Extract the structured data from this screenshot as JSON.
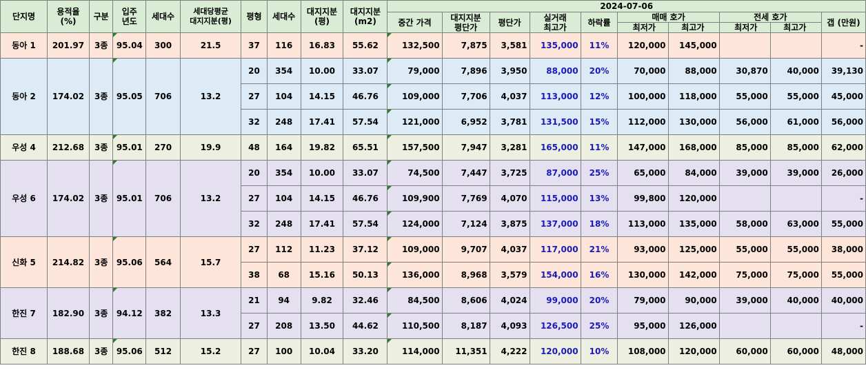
{
  "header": {
    "date": "2024-07-06",
    "complex": "단지명",
    "far": "용적율\n(%)",
    "zone": "구분",
    "year": "입주\n년도",
    "households": "세대수",
    "avg_land": "세대당평균\n대지지분(평)",
    "type": "평형",
    "type_households": "세대수",
    "land_pyeong": "대지지분\n(평)",
    "land_m2": "대지지분\n(m2)",
    "median_price": "중간 가격",
    "land_unit_price": "대지지분\n평단가",
    "unit_price": "평단가",
    "max_real_trade": "실거래\n최고가",
    "drop_rate": "하락률",
    "sale_group": "매매 호가",
    "jeonse_group": "전세 호가",
    "min": "최저가",
    "max": "최고가",
    "gap": "갭 (만원)"
  },
  "groups": [
    {
      "name": "동아 1",
      "far": "201.97",
      "zone": "3종",
      "year": "95.04",
      "households": "300",
      "avg_land": "21.5",
      "bg": "peach",
      "rows": [
        {
          "type": "37",
          "hh": "116",
          "lp": "16.83",
          "lm": "55.62",
          "median": "132,500",
          "lup": "7,875",
          "up": "3,581",
          "max": "135,000",
          "drop": "11%",
          "smin": "120,000",
          "smax": "145,000",
          "jmin": "",
          "jmax": "",
          "gap": "-"
        }
      ]
    },
    {
      "name": "동아 2",
      "far": "174.02",
      "zone": "3종",
      "year": "95.05",
      "households": "706",
      "avg_land": "13.2",
      "bg": "blue",
      "rows": [
        {
          "type": "20",
          "hh": "354",
          "lp": "10.00",
          "lm": "33.07",
          "median": "79,000",
          "lup": "7,896",
          "up": "3,950",
          "max": "88,000",
          "drop": "20%",
          "smin": "70,000",
          "smax": "88,000",
          "jmin": "30,870",
          "jmax": "40,000",
          "gap": "39,130"
        },
        {
          "type": "27",
          "hh": "104",
          "lp": "14.15",
          "lm": "46.76",
          "median": "109,000",
          "lup": "7,706",
          "up": "4,037",
          "max": "113,000",
          "drop": "12%",
          "smin": "100,000",
          "smax": "118,000",
          "jmin": "55,000",
          "jmax": "55,000",
          "gap": "45,000"
        },
        {
          "type": "32",
          "hh": "248",
          "lp": "17.41",
          "lm": "57.54",
          "median": "121,000",
          "lup": "6,952",
          "up": "3,781",
          "max": "131,500",
          "drop": "15%",
          "smin": "112,000",
          "smax": "130,000",
          "jmin": "56,000",
          "jmax": "61,000",
          "gap": "56,000"
        }
      ]
    },
    {
      "name": "우성 4",
      "far": "212.68",
      "zone": "3종",
      "year": "95.01",
      "households": "270",
      "avg_land": "19.9",
      "bg": "green",
      "rows": [
        {
          "type": "48",
          "hh": "164",
          "lp": "19.82",
          "lm": "65.51",
          "median": "157,500",
          "lup": "7,947",
          "up": "3,281",
          "max": "165,000",
          "drop": "11%",
          "smin": "147,000",
          "smax": "168,000",
          "jmin": "85,000",
          "jmax": "85,000",
          "gap": "62,000"
        }
      ]
    },
    {
      "name": "우성 6",
      "far": "174.02",
      "zone": "3종",
      "year": "95.01",
      "households": "706",
      "avg_land": "13.2",
      "bg": "purple",
      "rows": [
        {
          "type": "20",
          "hh": "354",
          "lp": "10.00",
          "lm": "33.07",
          "median": "74,500",
          "lup": "7,447",
          "up": "3,725",
          "max": "87,000",
          "drop": "25%",
          "smin": "65,000",
          "smax": "84,000",
          "jmin": "39,000",
          "jmax": "39,000",
          "gap": "26,000"
        },
        {
          "type": "27",
          "hh": "104",
          "lp": "14.15",
          "lm": "46.76",
          "median": "109,900",
          "lup": "7,769",
          "up": "4,070",
          "max": "115,000",
          "drop": "13%",
          "smin": "99,800",
          "smax": "120,000",
          "jmin": "",
          "jmax": "",
          "gap": "-"
        },
        {
          "type": "32",
          "hh": "248",
          "lp": "17.41",
          "lm": "57.54",
          "median": "124,000",
          "lup": "7,124",
          "up": "3,875",
          "max": "137,000",
          "drop": "18%",
          "smin": "113,000",
          "smax": "135,000",
          "jmin": "58,000",
          "jmax": "63,000",
          "gap": "55,000"
        }
      ]
    },
    {
      "name": "신화 5",
      "far": "214.82",
      "zone": "3종",
      "year": "95.06",
      "households": "564",
      "avg_land": "15.7",
      "bg": "peach",
      "rows": [
        {
          "type": "27",
          "hh": "112",
          "lp": "11.23",
          "lm": "37.12",
          "median": "109,000",
          "lup": "9,707",
          "up": "4,037",
          "max": "117,000",
          "drop": "21%",
          "smin": "93,000",
          "smax": "125,000",
          "jmin": "55,000",
          "jmax": "55,000",
          "gap": "38,000"
        },
        {
          "type": "38",
          "hh": "68",
          "lp": "15.16",
          "lm": "50.13",
          "median": "136,000",
          "lup": "8,968",
          "up": "3,579",
          "max": "154,000",
          "drop": "16%",
          "smin": "130,000",
          "smax": "142,000",
          "jmin": "75,000",
          "jmax": "75,000",
          "gap": "55,000"
        }
      ]
    },
    {
      "name": "한진 7",
      "far": "182.90",
      "zone": "3종",
      "year": "94.12",
      "households": "382",
      "avg_land": "13.3",
      "bg": "purple",
      "rows": [
        {
          "type": "21",
          "hh": "94",
          "lp": "9.82",
          "lm": "32.46",
          "median": "84,500",
          "lup": "8,606",
          "up": "4,024",
          "max": "99,000",
          "drop": "20%",
          "smin": "79,000",
          "smax": "90,000",
          "jmin": "39,000",
          "jmax": "40,000",
          "gap": "40,000"
        },
        {
          "type": "27",
          "hh": "208",
          "lp": "13.50",
          "lm": "44.62",
          "median": "110,500",
          "lup": "8,187",
          "up": "4,093",
          "max": "126,500",
          "drop": "25%",
          "smin": "95,000",
          "smax": "126,000",
          "jmin": "",
          "jmax": "",
          "gap": "-"
        }
      ]
    },
    {
      "name": "한진 8",
      "far": "188.68",
      "zone": "3종",
      "year": "95.06",
      "households": "512",
      "avg_land": "15.2",
      "bg": "green",
      "rows": [
        {
          "type": "27",
          "hh": "100",
          "lp": "10.04",
          "lm": "33.20",
          "median": "114,000",
          "lup": "11,351",
          "up": "4,222",
          "max": "120,000",
          "drop": "10%",
          "smin": "108,000",
          "smax": "120,000",
          "jmin": "60,000",
          "jmax": "60,000",
          "gap": "48,000"
        }
      ]
    }
  ]
}
